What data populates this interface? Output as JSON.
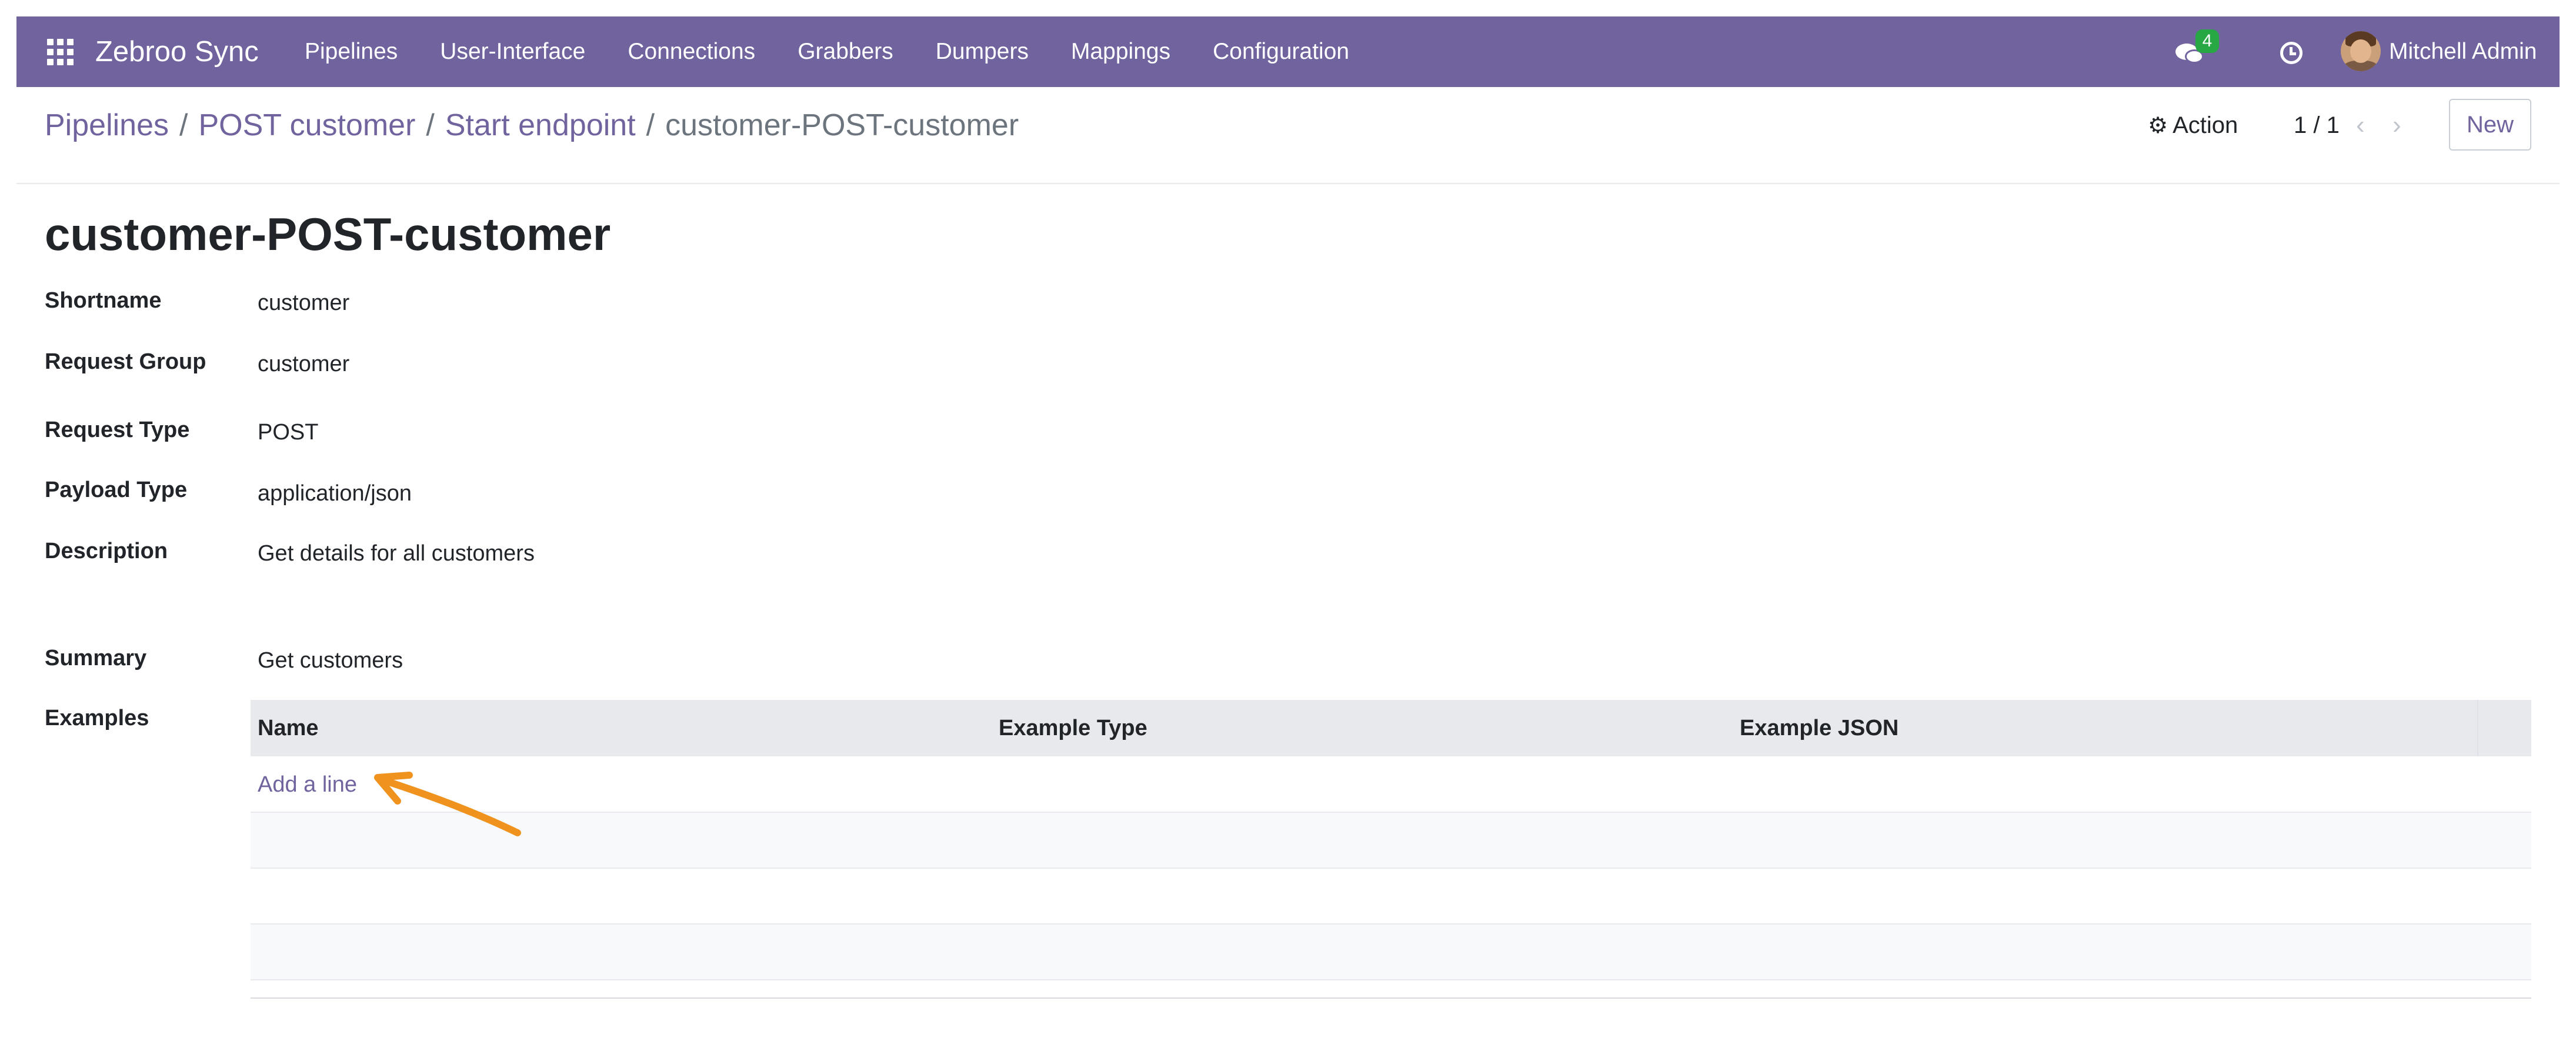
{
  "navbar": {
    "brand": "Zebroo Sync",
    "menu": [
      "Pipelines",
      "User-Interface",
      "Connections",
      "Grabbers",
      "Dumpers",
      "Mappings",
      "Configuration"
    ],
    "messages_badge": "4",
    "user_name": "Mitchell Admin",
    "accent_color": "#71639e"
  },
  "breadcrumb": {
    "items": [
      "Pipelines",
      "POST customer",
      "Start endpoint"
    ],
    "separator": "/",
    "current": "customer-POST-customer"
  },
  "control": {
    "action_label": "Action",
    "pager": "1 / 1",
    "new_label": "New"
  },
  "record": {
    "title": "customer-POST-customer",
    "fields": {
      "shortname": {
        "label": "Shortname",
        "value": "customer"
      },
      "request_group": {
        "label": "Request Group",
        "value": "customer"
      },
      "request_type": {
        "label": "Request Type",
        "value": "POST"
      },
      "payload_type": {
        "label": "Payload Type",
        "value": "application/json"
      },
      "description": {
        "label": "Description",
        "value": "Get details for all customers"
      },
      "summary": {
        "label": "Summary",
        "value": "Get customers"
      },
      "examples": {
        "label": "Examples"
      }
    }
  },
  "examples_table": {
    "columns": [
      "Name",
      "Example Type",
      "Example JSON"
    ],
    "add_line": "Add a line",
    "rows": []
  },
  "annotation": {
    "arrow_color": "#f0931e"
  }
}
